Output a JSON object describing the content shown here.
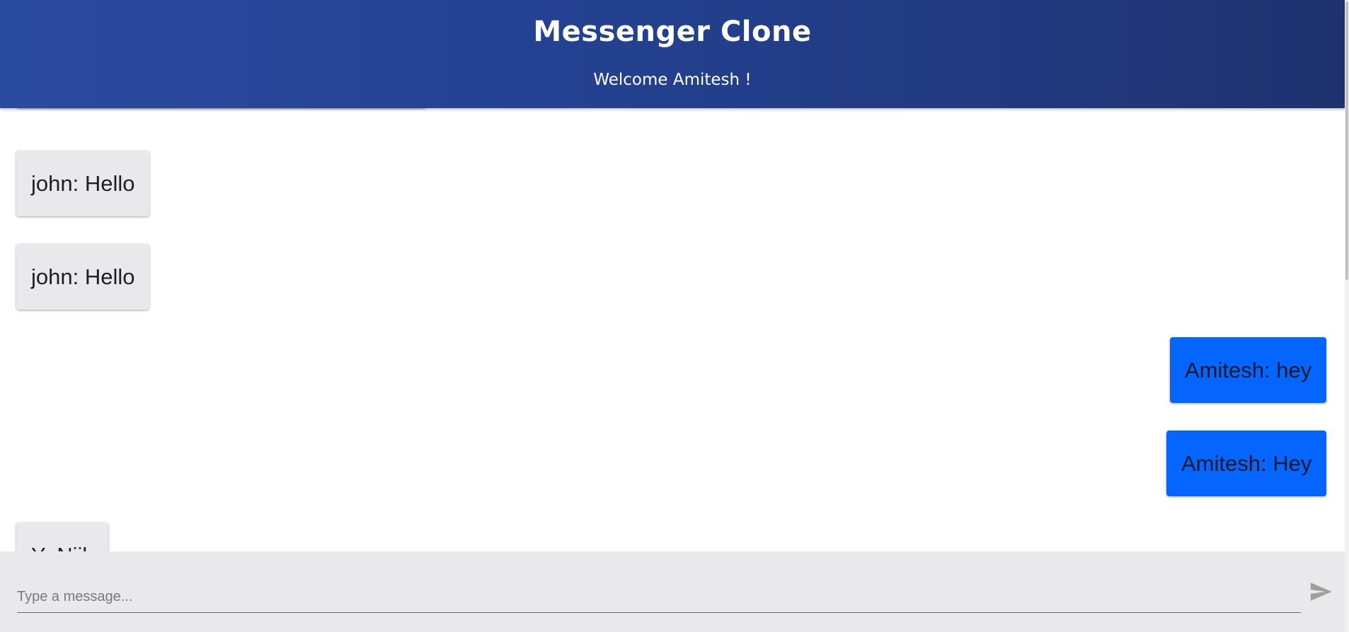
{
  "header": {
    "title": "Messenger Clone",
    "subtitle": "Welcome Amitesh !"
  },
  "messages": [
    {
      "text": "",
      "side": "left"
    },
    {
      "text": "john: Hello",
      "side": "left"
    },
    {
      "text": "john: Hello",
      "side": "left"
    },
    {
      "text": "Amitesh: hey",
      "side": "right"
    },
    {
      "text": "Amitesh: Hey",
      "side": "right"
    },
    {
      "text": "Y: Niik",
      "side": "left"
    }
  ],
  "composer": {
    "placeholder": "Type a message..."
  },
  "icons": {
    "send": "send-icon"
  },
  "colors": {
    "header": "#23408e",
    "own_bubble": "#0466ff",
    "other_bubble": "#e9e9eb",
    "composer_bg": "#e9e9eb"
  }
}
